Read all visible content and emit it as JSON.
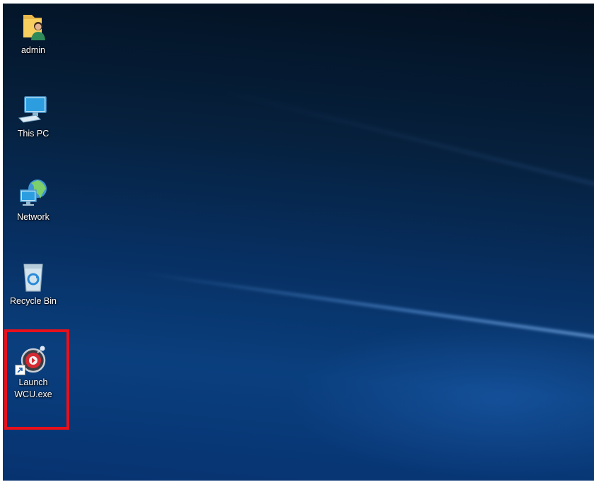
{
  "desktop": {
    "icons": [
      {
        "label": "admin",
        "icon": "user-folder-icon"
      },
      {
        "label": "This PC",
        "icon": "computer-icon"
      },
      {
        "label": "Network",
        "icon": "network-icon"
      },
      {
        "label": "Recycle Bin",
        "icon": "recycle-bin-icon"
      },
      {
        "label": "Launch WCU.exe",
        "icon": "wcu-app-icon",
        "shortcut": true,
        "highlighted": true
      }
    ]
  },
  "colors": {
    "highlight_border": "#e8101a",
    "wallpaper_dark": "#03101f",
    "wallpaper_light": "#0a3f7e"
  }
}
